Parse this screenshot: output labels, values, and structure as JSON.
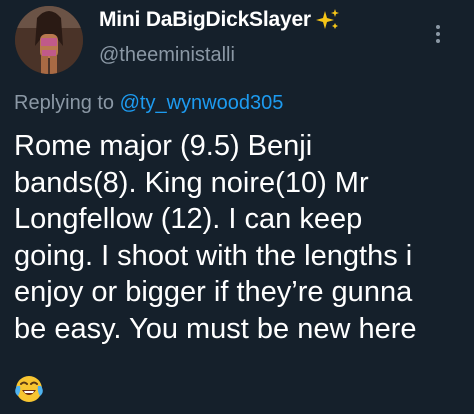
{
  "author": {
    "display_name": "Mini DaBigDickSlayer",
    "handle": "@theeministalli",
    "verified_icon": "sparkles-icon"
  },
  "reply": {
    "prefix": "Replying to",
    "handle": "@ty_wynwood305"
  },
  "tweet": {
    "lines": [
      "Rome major (9.5) Benji",
      "bands(8). King noire(10) Mr",
      "Longfellow (12).  I can keep",
      "going. I shoot with the lengths i",
      "enjoy or bigger if they’re gunna",
      "be easy. You must be new here"
    ],
    "emoji": "face-with-tears-of-joy-icon"
  },
  "menu": {
    "icon": "more-vertical-icon"
  },
  "colors": {
    "background": "#15202b",
    "text": "#ffffff",
    "secondary": "#8b98a5",
    "link": "#1d9bf0",
    "sparkle": "#f5c518"
  }
}
